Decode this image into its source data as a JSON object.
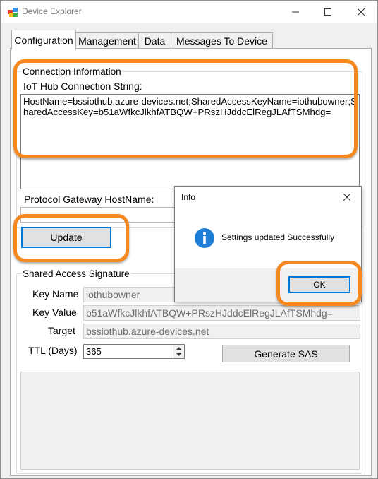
{
  "window": {
    "title": "Device Explorer"
  },
  "caption_buttons": {
    "minimize": "—",
    "maximize": "☐",
    "close": "✕"
  },
  "tabs": [
    {
      "label": "Configuration",
      "active": true
    },
    {
      "label": "Management"
    },
    {
      "label": "Data"
    },
    {
      "label": "Messages To Device"
    }
  ],
  "connection": {
    "legend": "Connection Information",
    "conn_label": "IoT Hub Connection String:",
    "conn_value": "HostName=bssiothub.azure-devices.net;SharedAccessKeyName=iothubowner;SharedAccessKey=b51aWfkcJlkhfATBQW+PRszHJddcElRegJLAfTSMhdg=",
    "gateway_label": "Protocol Gateway HostName:",
    "gateway_value": "",
    "update_button": "Update"
  },
  "sas": {
    "legend": "Shared Access Signature",
    "key_name_label": "Key Name",
    "key_name_value": "iothubowner",
    "key_value_label": "Key Value",
    "key_value_value": "b51aWfkcJlkhfATBQW+PRszHJddcElRegJLAfTSMhdg=",
    "target_label": "Target",
    "target_value": "bssiothub.azure-devices.net",
    "ttl_label": "TTL (Days)",
    "ttl_value": "365",
    "generate_button": "Generate SAS",
    "output_value": ""
  },
  "dialog": {
    "title": "Info",
    "message": "Settings updated Successfully",
    "ok_button": "OK",
    "icon": "info-icon",
    "close": "✕"
  },
  "colors": {
    "highlight": "#f5891f",
    "focus": "#0078d7",
    "info_icon": "#1e7fd8"
  }
}
